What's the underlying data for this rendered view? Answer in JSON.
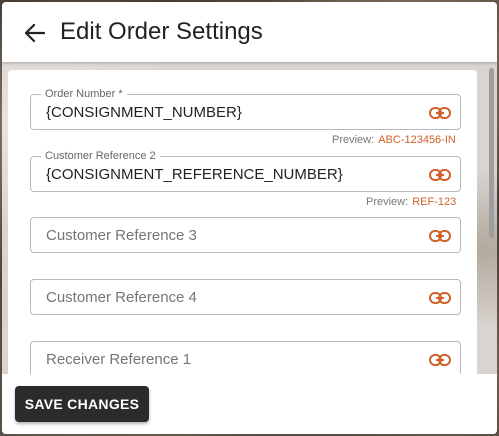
{
  "header": {
    "title": "Edit Order Settings",
    "back_icon": "arrow-left-icon"
  },
  "fields": [
    {
      "legend": "Order Number *",
      "value": "{CONSIGNMENT_NUMBER}",
      "preview_label": "Preview:",
      "preview_value": "ABC-123456-IN"
    },
    {
      "legend": "Customer Reference 2",
      "value": "{CONSIGNMENT_REFERENCE_NUMBER}",
      "preview_label": "Preview:",
      "preview_value": "REF-123"
    },
    {
      "placeholder": "Customer Reference 3"
    },
    {
      "placeholder": "Customer Reference 4"
    },
    {
      "placeholder": "Receiver Reference 1"
    }
  ],
  "icons": {
    "link": "link-icon"
  },
  "colors": {
    "accent": "#d2622a",
    "button_bg": "#2b2b2b"
  },
  "footer": {
    "save_label": "SAVE CHANGES"
  }
}
